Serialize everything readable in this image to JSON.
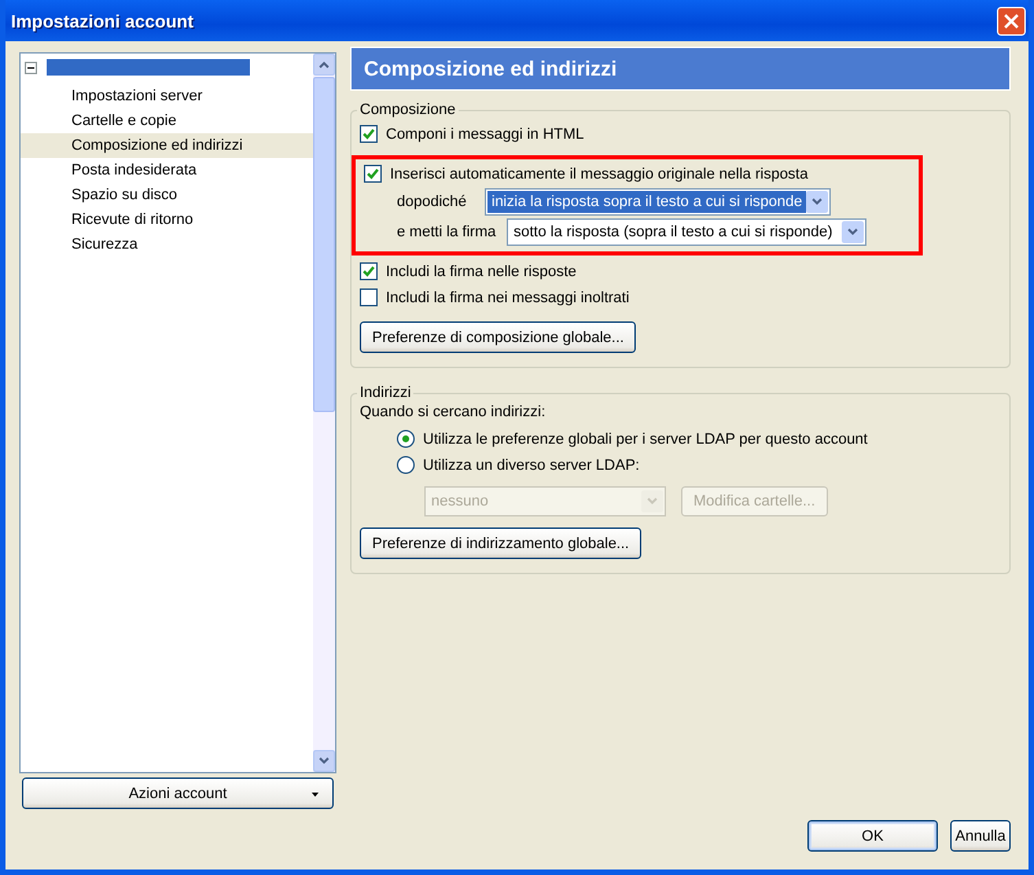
{
  "window": {
    "title": "Impostazioni account"
  },
  "tree": {
    "expanded": true,
    "items": [
      {
        "label": "Impostazioni server",
        "selected": false
      },
      {
        "label": "Cartelle e copie",
        "selected": false
      },
      {
        "label": "Composizione ed indirizzi",
        "selected": true
      },
      {
        "label": "Posta indesiderata",
        "selected": false
      },
      {
        "label": "Spazio su disco",
        "selected": false
      },
      {
        "label": "Ricevute di ritorno",
        "selected": false
      },
      {
        "label": "Sicurezza",
        "selected": false
      }
    ]
  },
  "account_actions_button": "Azioni account",
  "page_title": "Composizione ed indirizzi",
  "composition": {
    "legend": "Composizione",
    "html_option": {
      "label": "Componi i messaggi in HTML",
      "checked": true
    },
    "quote_group": {
      "highlighted": true,
      "option": {
        "label": "Inserisci automaticamente il messaggio originale nella risposta",
        "checked": true
      },
      "then_label": "dopodiché",
      "then_select": {
        "value": "inizia la risposta sopra il testo a cui si risponde",
        "focused": true
      },
      "signature_label": "e metti la firma",
      "signature_select": {
        "value": "sotto la risposta (sopra il testo a cui si risponde)",
        "focused": false
      }
    },
    "options": [
      {
        "label": "Includi la firma nelle risposte",
        "checked": true
      },
      {
        "label": "Includi la firma nei messaggi inoltrati",
        "checked": false
      }
    ],
    "button": "Preferenze di composizione globale..."
  },
  "addresses": {
    "legend": "Indirizzi",
    "prompt": "Quando si cercano indirizzi:",
    "radios": [
      {
        "label": "Utilizza le preferenze globali per i server LDAP per questo account",
        "selected": true
      },
      {
        "label": "Utilizza un diverso server LDAP:",
        "selected": false
      }
    ],
    "server_select": {
      "value": "nessuno",
      "disabled": true
    },
    "edit_button": {
      "label": "Modifica cartelle...",
      "disabled": true
    },
    "button": "Preferenze di indirizzamento globale..."
  },
  "buttons": [
    {
      "label": "OK",
      "default": true
    },
    {
      "label": "Annulla",
      "default": false
    }
  ]
}
